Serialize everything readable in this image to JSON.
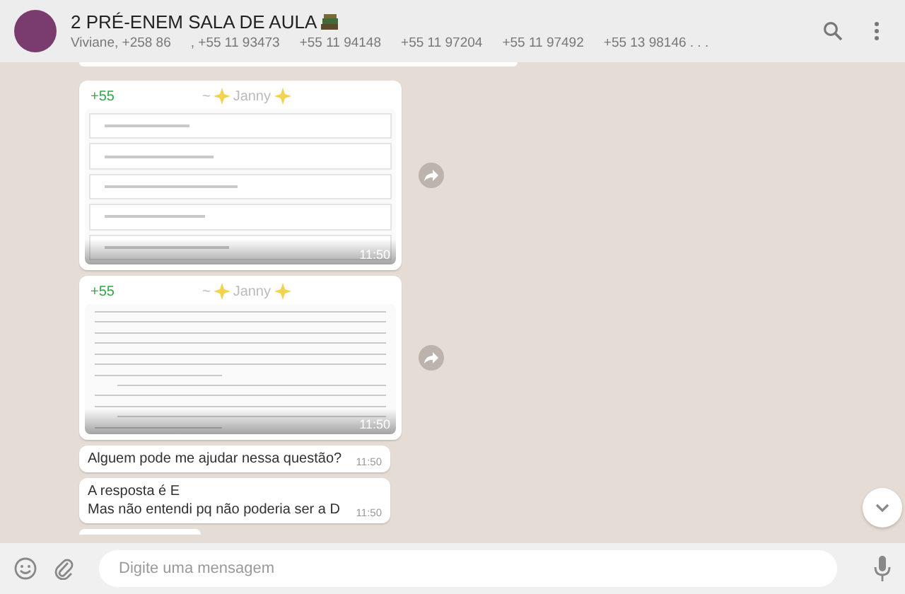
{
  "header": {
    "title": "2 PRÉ-ENEM SALA DE AULA",
    "participants": [
      "Viviane, +258 86",
      ", +55 11 93473",
      "+55 11 94148",
      "+55 11 97204",
      "+55 11 97492",
      "+55 13 98146 . . ."
    ]
  },
  "messages": [
    {
      "kind": "options",
      "sender": "+55",
      "author_prefix": "~",
      "author": "Janny",
      "time": "11:50"
    },
    {
      "kind": "article",
      "sender": "+55",
      "author_prefix": "~",
      "author": "Janny",
      "time": "11:50"
    },
    {
      "kind": "text",
      "text": "Alguem pode me ajudar nessa questão?",
      "time": "11:50"
    },
    {
      "kind": "text",
      "text": "A resposta é E\nMas não entendi pq não poderia ser a D",
      "time": "11:50"
    }
  ],
  "composer": {
    "placeholder": "Digite uma mensagem"
  }
}
